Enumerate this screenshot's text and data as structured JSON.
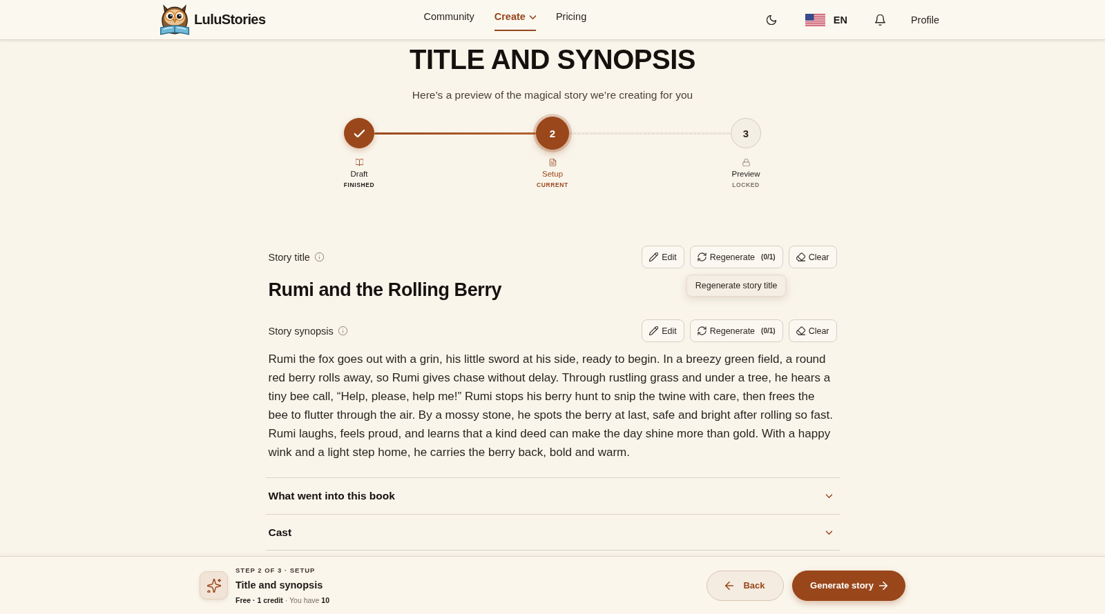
{
  "header": {
    "brand": "LuluStories",
    "nav": [
      {
        "label": "Community",
        "selected": false,
        "kind": "link"
      },
      {
        "label": "Create",
        "selected": true,
        "kind": "dropdown"
      },
      {
        "label": "Pricing",
        "selected": false,
        "kind": "link"
      }
    ],
    "language": "EN",
    "profile": "Profile"
  },
  "page": {
    "title": "TITLE AND SYNOPSIS",
    "subtitle": "Here’s a preview of the magical story we’re creating for you"
  },
  "stepper": {
    "steps": [
      {
        "label": "Draft",
        "status": "FINISHED",
        "completed": true,
        "selected": false
      },
      {
        "number": "2",
        "label": "Setup",
        "status": "CURRENT",
        "completed": false,
        "selected": true
      },
      {
        "number": "3",
        "label": "Preview",
        "status": "LOCKED",
        "completed": false,
        "selected": false
      }
    ]
  },
  "fields": [
    {
      "kind": "title",
      "label": "Story title",
      "value": "Rumi and the Rolling Berry",
      "actions": [
        {
          "kind": "edit",
          "label": "Edit"
        },
        {
          "kind": "regenerate",
          "label": "Regenerate",
          "count": "(0/1)",
          "tooltip": "Regenerate story title"
        },
        {
          "kind": "clear",
          "label": "Clear"
        }
      ]
    },
    {
      "kind": "text",
      "label": "Story synopsis",
      "value": "Rumi the fox goes out with a grin, his little sword at his side, ready to begin. In a breezy green field, a round red berry rolls away, so Rumi gives chase without delay. Through rustling grass and under a tree, he hears a tiny bee call, “Help, please, help me!” Rumi stops his berry hunt to snip the twine with care, then frees the bee to flutter through the air. By a mossy stone, he spots the berry at last, safe and bright after rolling so fast. Rumi laughs, feels proud, and learns that a kind deed can make the day shine more than gold. With a happy wink and a light step home, he carries the berry back, bold and warm.",
      "actions": [
        {
          "kind": "edit",
          "label": "Edit"
        },
        {
          "kind": "regenerate",
          "label": "Regenerate",
          "count": "(0/1)"
        },
        {
          "kind": "clear",
          "label": "Clear"
        }
      ]
    }
  ],
  "accordions": [
    {
      "label": "What went into this book",
      "expanded": false
    },
    {
      "label": "Cast",
      "expanded": false
    }
  ],
  "footer": {
    "caption": "STEP 2 OF 3 · SETUP",
    "title": "Title and synopsis",
    "credits": "**Free · 1 credit** · You have **10**",
    "buttons": [
      {
        "kind": "back",
        "label": "Back"
      },
      {
        "kind": "primary",
        "label": "Generate story"
      }
    ]
  }
}
